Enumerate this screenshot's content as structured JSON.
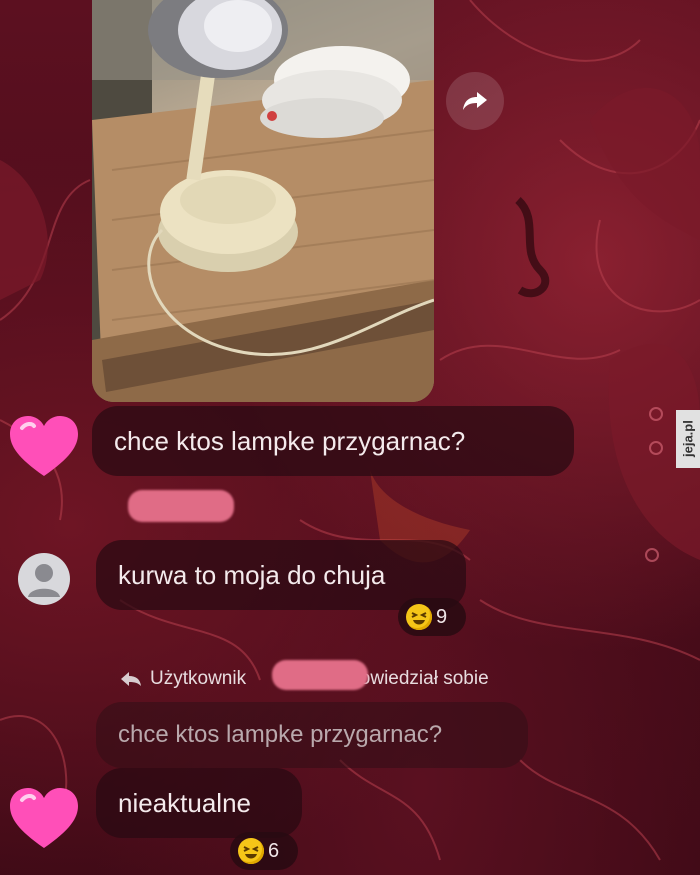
{
  "messages": [
    {
      "text": "chce ktos lampke przygarnac?"
    },
    {
      "text": "kurwa to moja do chuja",
      "reaction_count": "9"
    },
    {
      "text": "nieaktualne",
      "reaction_count": "6"
    }
  ],
  "reply": {
    "prefix": "Użytkownik",
    "suffix": "odpowiedział sobie",
    "quoted_text": "chce ktos lampke przygarnac?"
  },
  "watermark": "jeja.pl",
  "colors": {
    "background": "#4a0c1a",
    "bubble": "#2a0a12",
    "redaction": "#e06c86",
    "heart": "#ff4fb8"
  },
  "icons": {
    "share": "share-arrow-icon",
    "reply": "reply-arrow-icon",
    "reaction": "laughing-emoji-icon"
  }
}
